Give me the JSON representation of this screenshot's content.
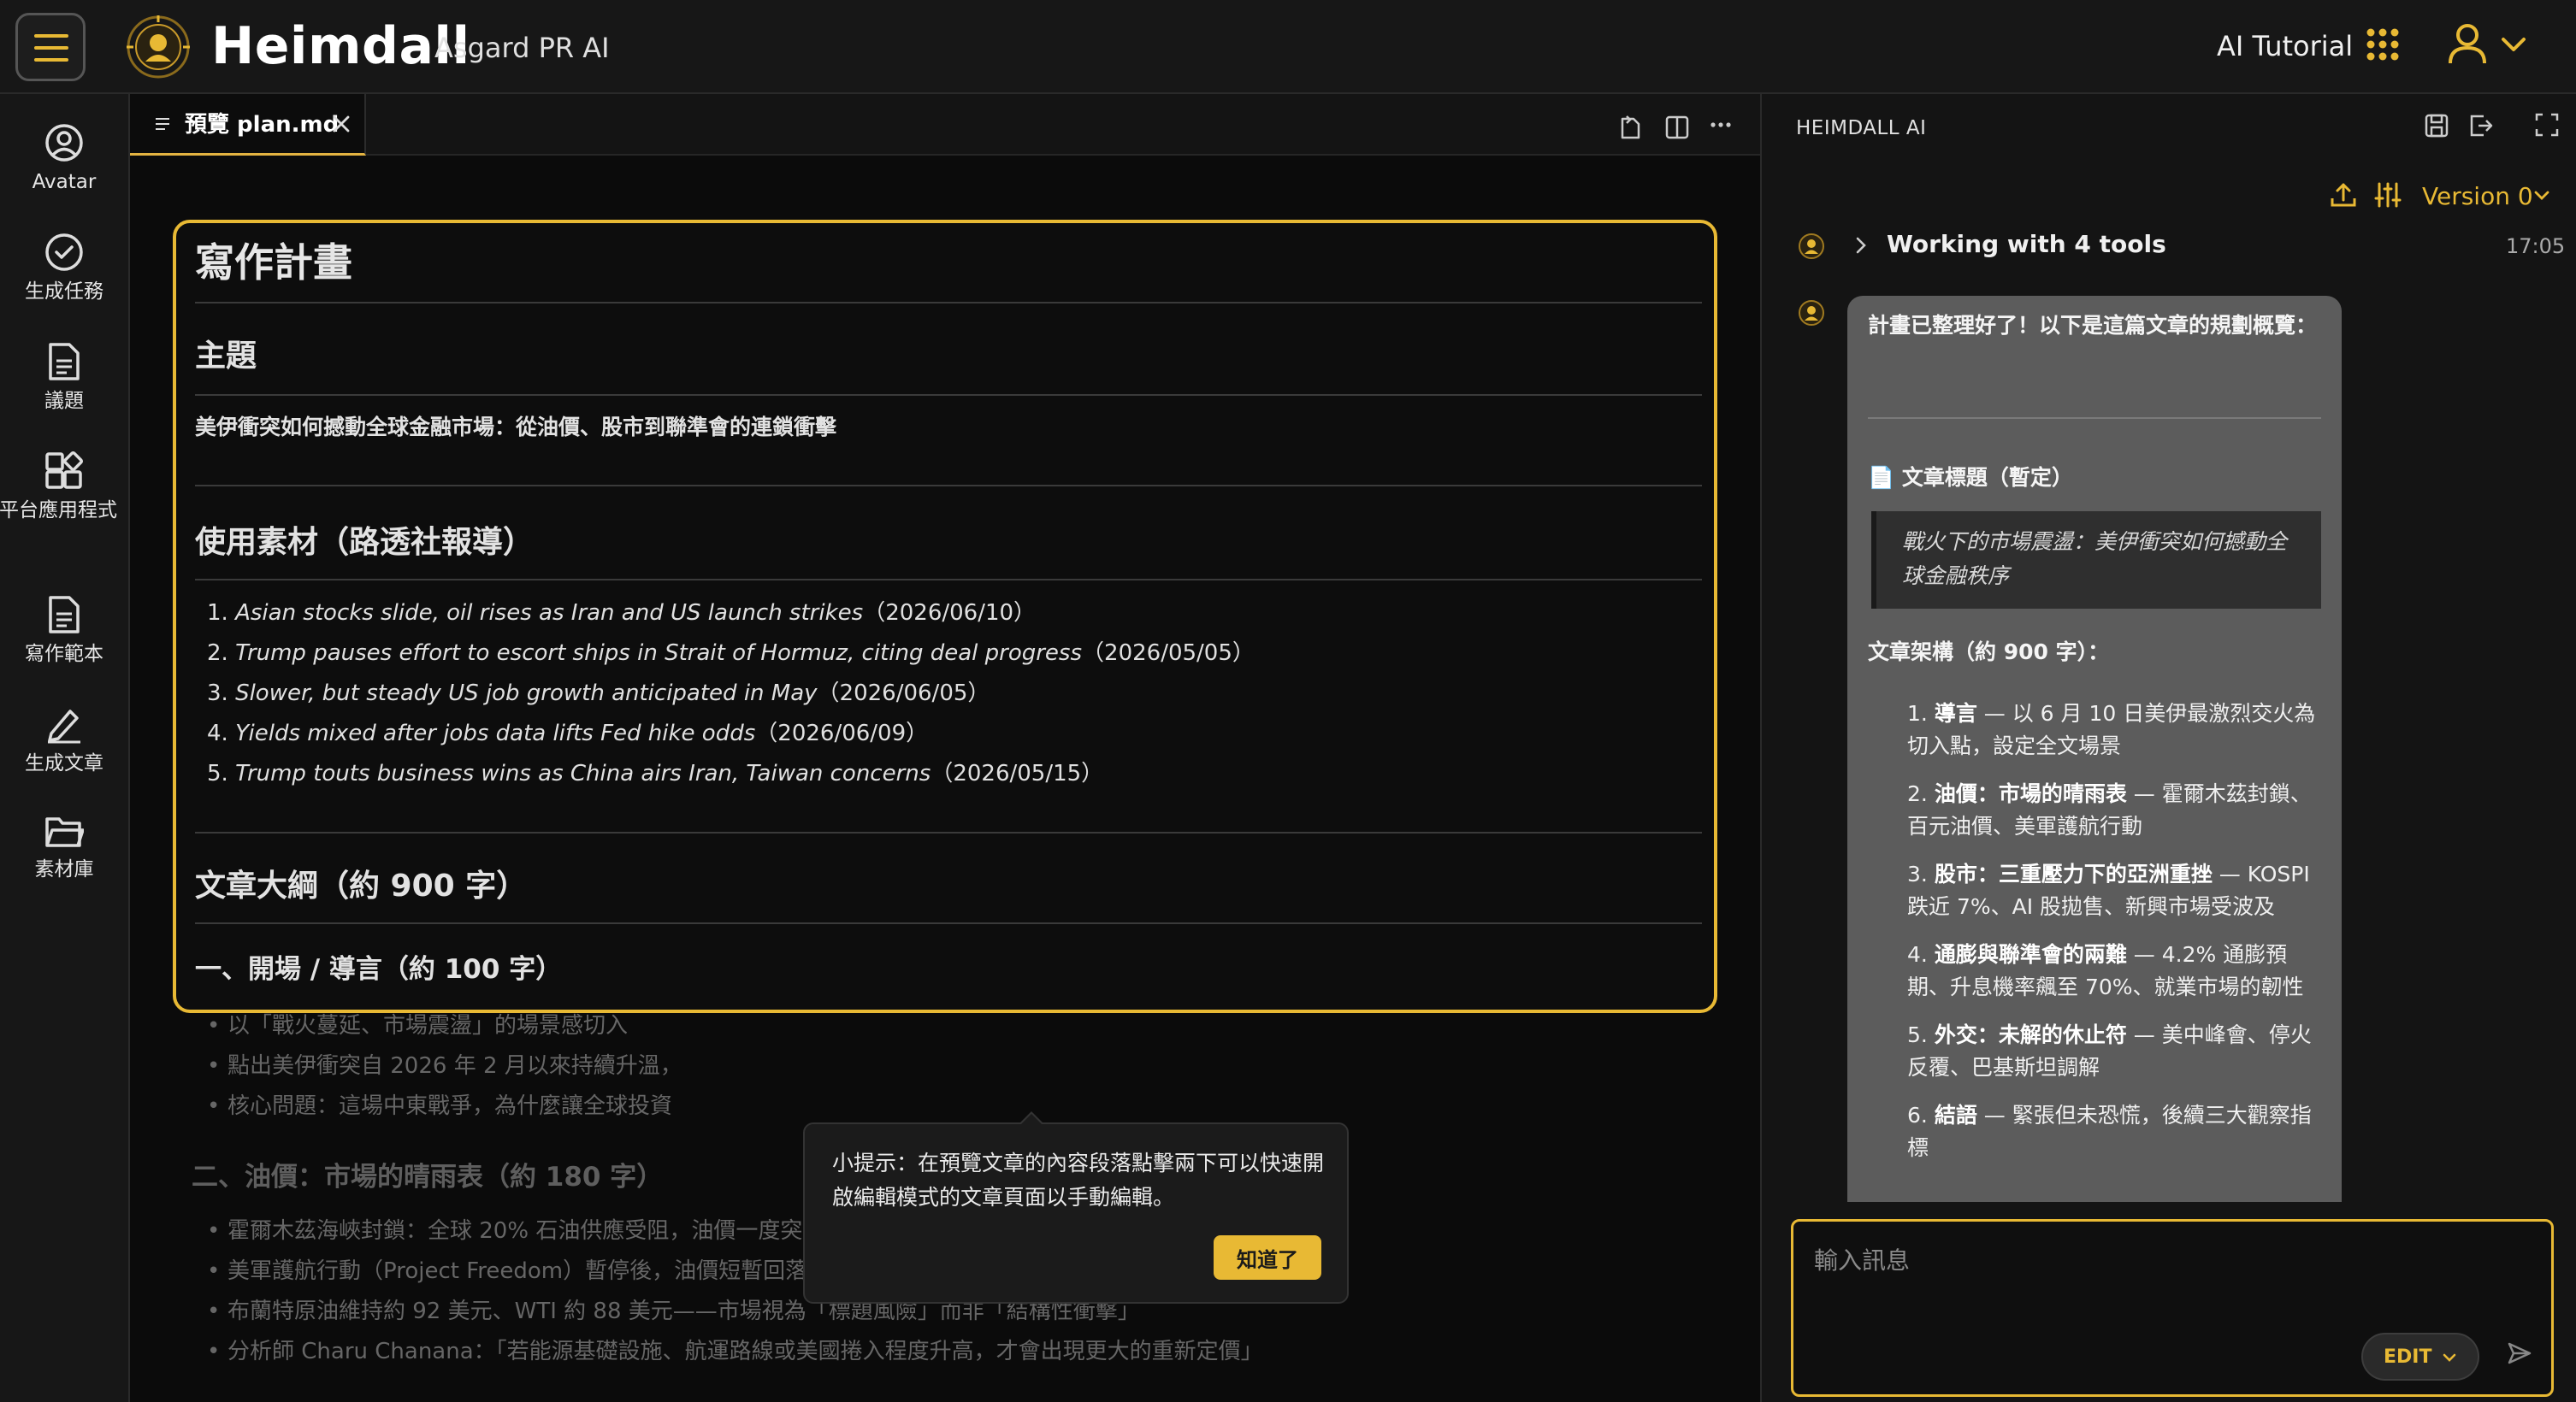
{
  "app": {
    "brand": "Heimdall",
    "subtitle": "Asgard PR AI",
    "tutorial": "AI Tutorial",
    "accent_color": "#e8b934",
    "icons": [
      "menu-icon",
      "heimdall-logo-icon",
      "apps-grid-icon",
      "user-icon",
      "chevron-down-icon"
    ]
  },
  "sidebar": {
    "items": [
      {
        "label": "Avatar",
        "icon": "avatar-icon"
      },
      {
        "label": "生成任務",
        "icon": "check-circle-icon"
      },
      {
        "label": "議題",
        "icon": "document-icon"
      },
      {
        "label": "平台應用程式",
        "icon": "apps-add-icon"
      },
      {
        "label": "寫作範本",
        "icon": "template-icon"
      },
      {
        "label": "生成文章",
        "icon": "pen-icon"
      },
      {
        "label": "素材庫",
        "icon": "folder-icon"
      }
    ]
  },
  "editor": {
    "tab_label": "預覽 plan.md",
    "doc": {
      "title": "寫作計畫",
      "topic_heading": "主題",
      "topic_text": "美伊衝突如何撼動全球金融市場：從油價、股市到聯準會的連鎖衝擊",
      "sources_heading": "使用素材（路透社報導）",
      "sources": [
        {
          "num": "1.",
          "title": "Asian stocks slide, oil rises as Iran and US launch strikes",
          "date": "（2026/06/10）"
        },
        {
          "num": "2.",
          "title": "Trump pauses effort to escort ships in Strait of Hormuz, citing deal progress",
          "date": "（2026/05/05）"
        },
        {
          "num": "3.",
          "title": "Slower, but steady US job growth anticipated in May",
          "date": "（2026/06/05）"
        },
        {
          "num": "4.",
          "title": "Yields mixed after jobs data lifts Fed hike odds",
          "date": "（2026/06/09）"
        },
        {
          "num": "5.",
          "title": "Trump touts business wins as China airs Iran, Taiwan concerns",
          "date": "（2026/05/15）"
        }
      ],
      "outline_heading": "文章大綱（約 900 字）",
      "section1_heading": "一、開場 / 導言（約 100 字）",
      "section1_items": [
        "以「戰火蔓延、市場震盪」的場景感切入",
        "點出美伊衝突自 2026 年 2 月以來持續升溫，",
        "核心問題：這場中東戰爭，為什麼讓全球投資"
      ],
      "section2_heading": "二、油價：市場的晴雨表（約 180 字）",
      "section2_items": [
        "霍爾木茲海峽封鎖：全球 20% 石油供應受阻，油價一度突破每桶 100 美元",
        "美軍護航行動（Project Freedom）暫停後，油價短暫回落，破百元門檻",
        "布蘭特原油維持約 92 美元、WTI 約 88 美元——市場視為「標題風險」而非「結構性衝擊」",
        "分析師 Charu Chanana：「若能源基礎設施、航運路線或美國捲入程度升高，才會出現更大的重新定價」"
      ]
    },
    "tooltip": {
      "text": "小提示：在預覽文章的內容段落點擊兩下可以快速開啟編輯模式的文章頁面以手動編輯。",
      "button": "知道了"
    }
  },
  "ai_panel": {
    "title": "HEIMDALL AI",
    "version": "Version 0",
    "tool_status": "Working with 4 tools",
    "tool_time": "17:05",
    "message": {
      "intro": "計畫已整理好了！以下是這篇文章的規劃概覽：",
      "title_label": "📄 文章標題（暫定）",
      "quote": "戰火下的市場震盪：美伊衝突如何撼動全球金融秩序",
      "structure_label": "文章架構（約 900 字）：",
      "items": [
        {
          "num": "1.",
          "bold": "導言",
          "rest": " — 以 6 月 10 日美伊最激烈交火為切入點，設定全文場景"
        },
        {
          "num": "2.",
          "bold": "油價：市場的晴雨表",
          "rest": " — 霍爾木茲封鎖、百元油價、美軍護航行動"
        },
        {
          "num": "3.",
          "bold": "股市：三重壓力下的亞洲重挫",
          "rest": " — KOSPI 跌近 7%、AI 股拋售、新興市場受波及"
        },
        {
          "num": "4.",
          "bold": "通膨與聯準會的兩難",
          "rest": " — 4.2% 通膨預期、升息機率飆至 70%、就業市場的韌性"
        },
        {
          "num": "5.",
          "bold": "外交：未解的休止符",
          "rest": " — 美中峰會、停火反覆、巴基斯坦調解"
        },
        {
          "num": "6.",
          "bold": "結語",
          "rest": " — 緊張但未恐慌，後續三大觀察指標"
        }
      ]
    },
    "composer": {
      "placeholder": "輸入訊息",
      "mode": "EDIT"
    }
  }
}
